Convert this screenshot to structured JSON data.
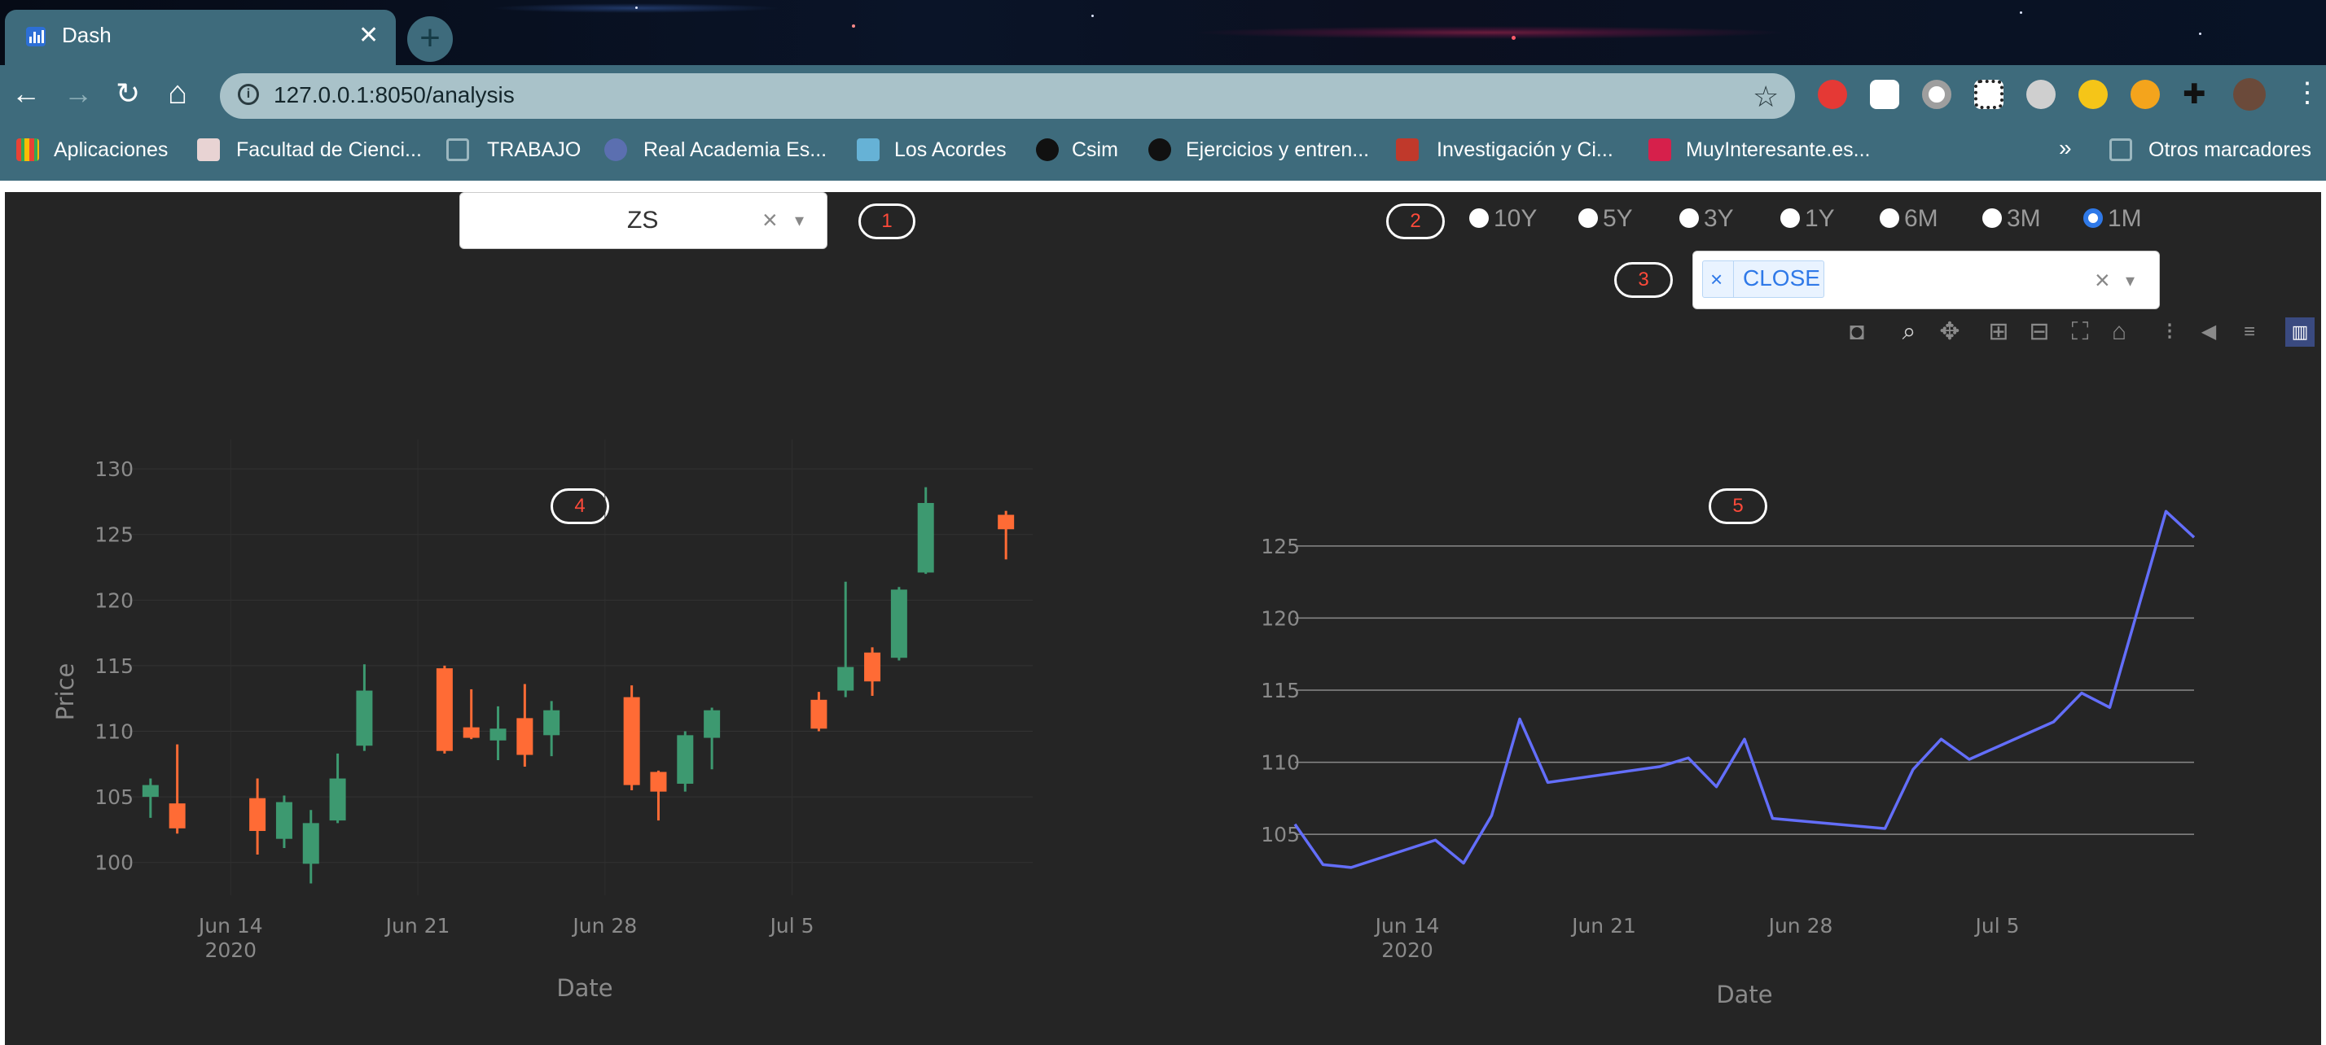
{
  "browser": {
    "tab_title": "Dash",
    "url": "127.0.0.1:8050/analysis",
    "bookmarks": [
      {
        "label": "Aplicaciones",
        "color": "#e94235"
      },
      {
        "label": "Facultad de Cienci...",
        "color": "#c0392b"
      },
      {
        "label": "TRABAJO",
        "color": "#4a6f7b"
      },
      {
        "label": "Real Academia Es...",
        "color": "#5b6fb0"
      },
      {
        "label": "Los Acordes",
        "color": "#66b2d6"
      },
      {
        "label": "Csim",
        "color": "#111111"
      },
      {
        "label": "Ejercicios y entren...",
        "color": "#111111"
      },
      {
        "label": "Investigación y Ci...",
        "color": "#c0392b"
      },
      {
        "label": "MuyInteresante.es...",
        "color": "#d6204b"
      }
    ],
    "bookmarks_more": "»",
    "other_bookmarks": "Otros marcadores"
  },
  "controls": {
    "ticker": {
      "value": "ZS",
      "clear": "×",
      "caret": "▾"
    },
    "periods": {
      "options": [
        "10Y",
        "5Y",
        "3Y",
        "1Y",
        "6M",
        "3M",
        "1M"
      ],
      "selected": "1M"
    },
    "columns": {
      "selected": [
        "CLOSE"
      ],
      "chip_remove": "×",
      "clear": "×",
      "caret": "▾"
    },
    "badges": [
      "1",
      "2",
      "3",
      "4",
      "5"
    ]
  },
  "modebar": [
    "camera-icon",
    "zoom-icon",
    "pan-icon",
    "zoom-in-icon",
    "zoom-out-icon",
    "autoscale-icon",
    "reset-axes-icon",
    "spike-lines-icon",
    "hover-closest-icon",
    "hover-compare-icon",
    "plotly-logo-icon"
  ],
  "chart_data": [
    {
      "type": "candlestick",
      "xlabel": "Date",
      "ylabel": "Price",
      "x_ticks": [
        "Jun 14\n2020",
        "Jun 21",
        "Jun 28",
        "Jul 5"
      ],
      "y_ticks": [
        100,
        105,
        110,
        115,
        120,
        125,
        130
      ],
      "ylim": [
        97.5,
        131
      ],
      "increasing_color": "#3d9970",
      "decreasing_color": "#ff6b35",
      "candles": [
        {
          "date": "2020-06-11",
          "open": 105.0,
          "high": 106.4,
          "low": 103.4,
          "close": 105.9
        },
        {
          "date": "2020-06-12",
          "open": 104.5,
          "high": 109.0,
          "low": 102.2,
          "close": 102.6
        },
        {
          "date": "2020-06-15",
          "open": 104.9,
          "high": 106.4,
          "low": 100.6,
          "close": 102.4
        },
        {
          "date": "2020-06-16",
          "open": 101.8,
          "high": 105.1,
          "low": 101.1,
          "close": 104.6
        },
        {
          "date": "2020-06-17",
          "open": 99.9,
          "high": 104.0,
          "low": 98.4,
          "close": 103.0
        },
        {
          "date": "2020-06-18",
          "open": 103.2,
          "high": 108.3,
          "low": 103.0,
          "close": 106.4
        },
        {
          "date": "2020-06-19",
          "open": 108.9,
          "high": 115.1,
          "low": 108.5,
          "close": 113.1
        },
        {
          "date": "2020-06-22",
          "open": 114.8,
          "high": 115.0,
          "low": 108.3,
          "close": 108.5
        },
        {
          "date": "2020-06-23",
          "open": 110.3,
          "high": 113.2,
          "low": 109.4,
          "close": 109.5
        },
        {
          "date": "2020-06-24",
          "open": 109.3,
          "high": 111.9,
          "low": 107.8,
          "close": 110.2
        },
        {
          "date": "2020-06-25",
          "open": 111.0,
          "high": 113.6,
          "low": 107.3,
          "close": 108.2
        },
        {
          "date": "2020-06-26",
          "open": 109.7,
          "high": 112.3,
          "low": 108.1,
          "close": 111.6
        },
        {
          "date": "2020-06-29",
          "open": 112.6,
          "high": 113.5,
          "low": 105.5,
          "close": 105.9
        },
        {
          "date": "2020-06-30",
          "open": 106.9,
          "high": 107.0,
          "low": 103.2,
          "close": 105.4
        },
        {
          "date": "2020-07-01",
          "open": 106.0,
          "high": 110.0,
          "low": 105.4,
          "close": 109.7
        },
        {
          "date": "2020-07-02",
          "open": 109.5,
          "high": 111.8,
          "low": 107.1,
          "close": 111.6
        },
        {
          "date": "2020-07-06",
          "open": 112.4,
          "high": 113.0,
          "low": 110.0,
          "close": 110.2
        },
        {
          "date": "2020-07-07",
          "open": 113.1,
          "high": 121.4,
          "low": 112.6,
          "close": 114.9
        },
        {
          "date": "2020-07-08",
          "open": 116.0,
          "high": 116.4,
          "low": 112.7,
          "close": 113.8
        },
        {
          "date": "2020-07-09",
          "open": 115.6,
          "high": 121.0,
          "low": 115.4,
          "close": 120.8
        },
        {
          "date": "2020-07-10",
          "open": 122.1,
          "high": 128.6,
          "low": 122.0,
          "close": 127.4
        },
        {
          "date": "2020-07-13",
          "open": 126.5,
          "high": 126.8,
          "low": 123.1,
          "close": 125.4
        }
      ]
    },
    {
      "type": "line",
      "xlabel": "Date",
      "ylabel": "",
      "x_ticks": [
        "Jun 14\n2020",
        "Jun 21",
        "Jun 28",
        "Jul 5"
      ],
      "y_ticks": [
        105,
        110,
        115,
        120,
        125
      ],
      "ylim": [
        101,
        129
      ],
      "line_color": "#636efa",
      "series": [
        {
          "values": [
            {
              "date": "2020-06-10",
              "close": 105.7
            },
            {
              "date": "2020-06-11",
              "close": 102.9
            },
            {
              "date": "2020-06-12",
              "close": 102.7
            },
            {
              "date": "2020-06-15",
              "close": 104.6
            },
            {
              "date": "2020-06-16",
              "close": 103.0
            },
            {
              "date": "2020-06-17",
              "close": 106.3
            },
            {
              "date": "2020-06-18",
              "close": 113.0
            },
            {
              "date": "2020-06-19",
              "close": 108.6
            },
            {
              "date": "2020-06-23",
              "close": 109.7
            },
            {
              "date": "2020-06-24",
              "close": 110.3
            },
            {
              "date": "2020-06-25",
              "close": 108.3
            },
            {
              "date": "2020-06-26",
              "close": 111.6
            },
            {
              "date": "2020-06-27",
              "close": 106.1
            },
            {
              "date": "2020-07-01",
              "close": 105.4
            },
            {
              "date": "2020-07-02",
              "close": 109.5
            },
            {
              "date": "2020-07-03",
              "close": 111.6
            },
            {
              "date": "2020-07-04",
              "close": 110.2
            },
            {
              "date": "2020-07-07",
              "close": 112.8
            },
            {
              "date": "2020-07-08",
              "close": 114.8
            },
            {
              "date": "2020-07-09",
              "close": 113.8
            },
            {
              "date": "2020-07-11",
              "close": 127.4
            },
            {
              "date": "2020-07-12",
              "close": 125.6
            }
          ]
        }
      ]
    }
  ]
}
